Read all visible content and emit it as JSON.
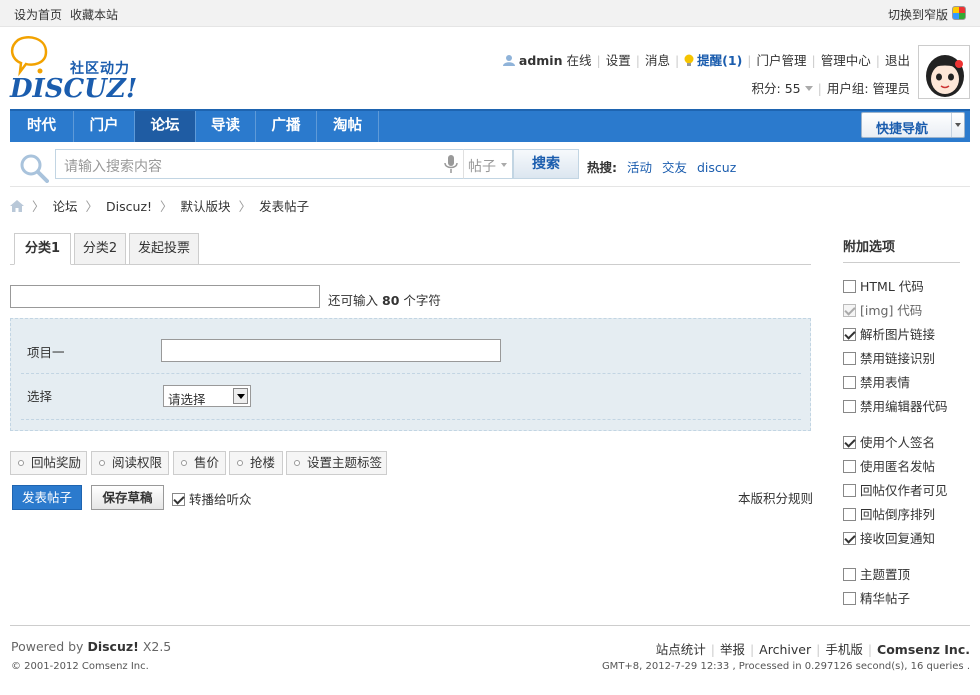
{
  "topbar": {
    "set_home": "设为首页",
    "bookmark": "收藏本站",
    "switch_width": "切换到窄版"
  },
  "logo": {
    "tagline": "社区动力",
    "brand": "DISCUZ!"
  },
  "user": {
    "name": "admin",
    "status": "在线",
    "settings": "设置",
    "messages": "消息",
    "remind": "提醒(1)",
    "portal_manage": "门户管理",
    "admin_center": "管理中心",
    "logout": "退出",
    "points": "积分: 55",
    "group": "用户组: 管理员"
  },
  "nav": {
    "items": [
      "时代",
      "门户",
      "论坛",
      "导读",
      "广播",
      "淘帖"
    ],
    "active": "论坛",
    "quick_nav": "快捷导航"
  },
  "search": {
    "placeholder": "请输入搜索内容",
    "type": "帖子",
    "button": "搜索",
    "hot_label": "热搜:",
    "hot_items": [
      "活动",
      "交友",
      "discuz"
    ]
  },
  "breadcrumb": [
    "论坛",
    "Discuz!",
    "默认版块",
    "发表帖子"
  ],
  "tabs": [
    "分类1",
    "分类2",
    "发起投票"
  ],
  "subject": {
    "hint_prefix": "还可输入",
    "hint_count": "80",
    "hint_suffix": "个字符"
  },
  "poll": {
    "label1": "项目一",
    "label2": "选择",
    "select_value": "请选择"
  },
  "extras": [
    "回帖奖励",
    "阅读权限",
    "售价",
    "抢楼",
    "设置主题标签"
  ],
  "actions": {
    "post": "发表帖子",
    "draft": "保存草稿",
    "broadcast": "转播给听众",
    "credit_rules": "本版积分规则"
  },
  "sidebar": {
    "title": "附加选项",
    "options": [
      {
        "label": "HTML 代码",
        "checked": false,
        "disabled": false
      },
      {
        "label": "[img] 代码",
        "checked": true,
        "disabled": true
      },
      {
        "label": "解析图片链接",
        "checked": true,
        "disabled": false
      },
      {
        "label": "禁用链接识别",
        "checked": false,
        "disabled": false
      },
      {
        "label": "禁用表情",
        "checked": false,
        "disabled": false
      },
      {
        "label": "禁用编辑器代码",
        "checked": false,
        "disabled": false
      },
      {
        "label": "使用个人签名",
        "checked": true,
        "disabled": false
      },
      {
        "label": "使用匿名发帖",
        "checked": false,
        "disabled": false
      },
      {
        "label": "回帖仅作者可见",
        "checked": false,
        "disabled": false
      },
      {
        "label": "回帖倒序排列",
        "checked": false,
        "disabled": false
      },
      {
        "label": "接收回复通知",
        "checked": true,
        "disabled": false
      },
      {
        "label": "主题置顶",
        "checked": false,
        "disabled": false
      },
      {
        "label": "精华帖子",
        "checked": false,
        "disabled": false
      }
    ]
  },
  "footer": {
    "powered_prefix": "Powered by",
    "powered_brand": "Discuz!",
    "version": "X2.5",
    "copyright": "© 2001-2012 Comsenz Inc.",
    "links": [
      "站点统计",
      "举报",
      "Archiver",
      "手机版"
    ],
    "company": "Comsenz Inc.",
    "stats": "GMT+8, 2012-7-29 12:33 , Processed in 0.297126 second(s), 16 queries ."
  },
  "colors": {
    "nav_bg": "#2b7acd",
    "nav_active": "#1f5ca3",
    "link_blue": "#1b5dae",
    "poll_bg": "#e5edf2"
  }
}
